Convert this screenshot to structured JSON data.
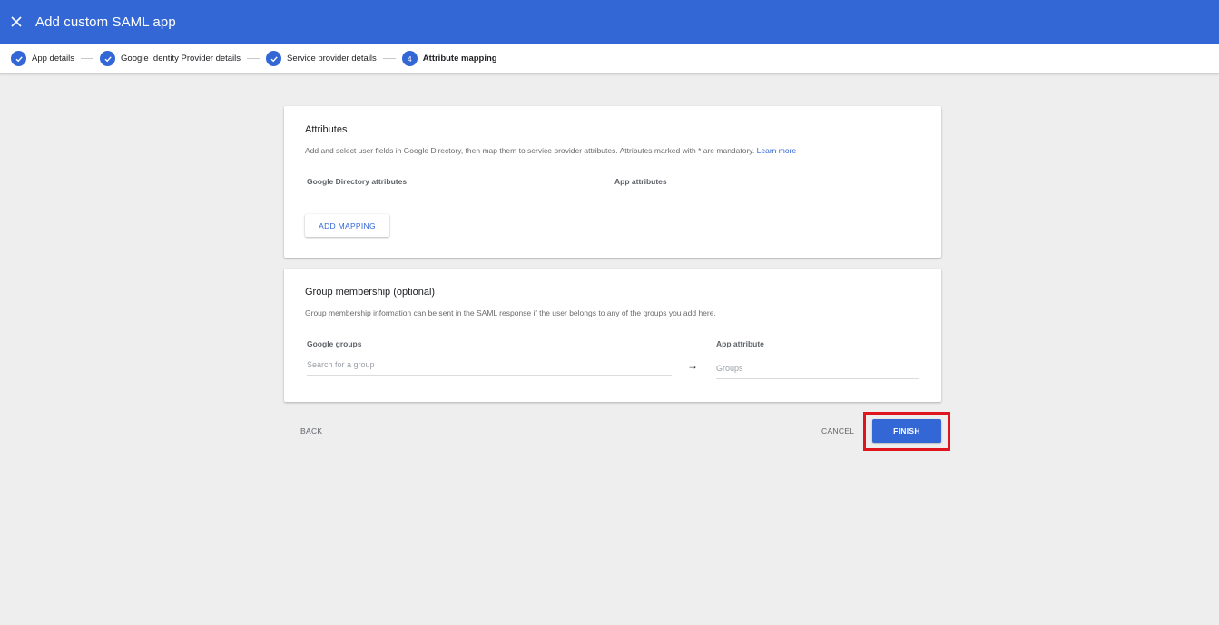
{
  "header": {
    "title": "Add custom SAML app",
    "close_icon": "close-icon"
  },
  "stepper": {
    "steps": [
      {
        "label": "App details",
        "state": "done"
      },
      {
        "label": "Google Identity Provider details",
        "state": "done"
      },
      {
        "label": "Service provider details",
        "state": "done"
      },
      {
        "label": "Attribute mapping",
        "state": "active",
        "number": "4"
      }
    ]
  },
  "attributes": {
    "title": "Attributes",
    "description": "Add and select user fields in Google Directory, then map them to service provider attributes. Attributes marked with * are mandatory.",
    "learn_more": "Learn more",
    "col_directory": "Google Directory attributes",
    "col_app": "App attributes",
    "add_mapping_label": "ADD MAPPING"
  },
  "group_membership": {
    "title": "Group membership (optional)",
    "description": "Group membership information can be sent in the SAML response if the user belongs to any of the groups you add here.",
    "col_groups": "Google groups",
    "col_app_attr": "App attribute",
    "search_placeholder": "Search for a group",
    "app_attr_placeholder": "Groups",
    "arrow": "→"
  },
  "footer": {
    "back_label": "BACK",
    "cancel_label": "CANCEL",
    "finish_label": "FINISH"
  },
  "colors": {
    "brand": "#3367d6",
    "highlight": "#e0161e",
    "background": "#eeeeee"
  }
}
